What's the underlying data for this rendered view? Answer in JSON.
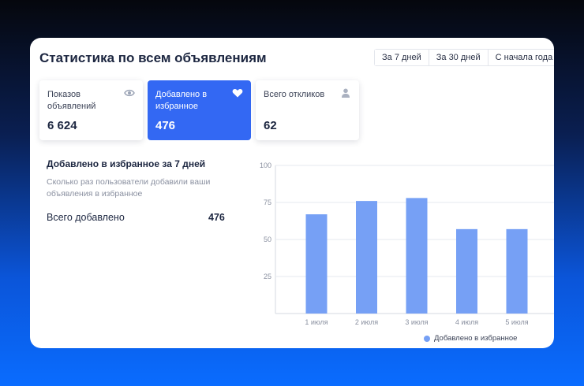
{
  "header": {
    "title": "Статистика по всем объявлениям"
  },
  "periods": [
    "За 7 дней",
    "За 30 дней",
    "С начала года"
  ],
  "stats": [
    {
      "label": "Показов объявлений",
      "value": "6 624",
      "icon": "eye-icon"
    },
    {
      "label": "Добавлено в избранное",
      "value": "476",
      "icon": "heart-icon"
    },
    {
      "label": "Всего откликов",
      "value": "62",
      "icon": "user-icon"
    }
  ],
  "section": {
    "title": "Добавлено в избранное за 7 дней",
    "subtitle": "Сколько раз пользователи добавили ваши объявления в избранное",
    "total_label": "Всего добавлено",
    "total_value": "476"
  },
  "colors": {
    "accent": "#3368f3",
    "bar": "#76a0f5"
  },
  "chart_data": {
    "type": "bar",
    "categories": [
      "1 июля",
      "2 июля",
      "3 июля",
      "4 июля",
      "5 июля"
    ],
    "series": [
      {
        "name": "Добавлено в избранное",
        "values": [
          67,
          76,
          78,
          57,
          57
        ]
      }
    ],
    "ylim": [
      0,
      100
    ],
    "yticks": [
      25,
      50,
      75,
      100
    ],
    "grid": true,
    "legend": "bottom-right"
  }
}
